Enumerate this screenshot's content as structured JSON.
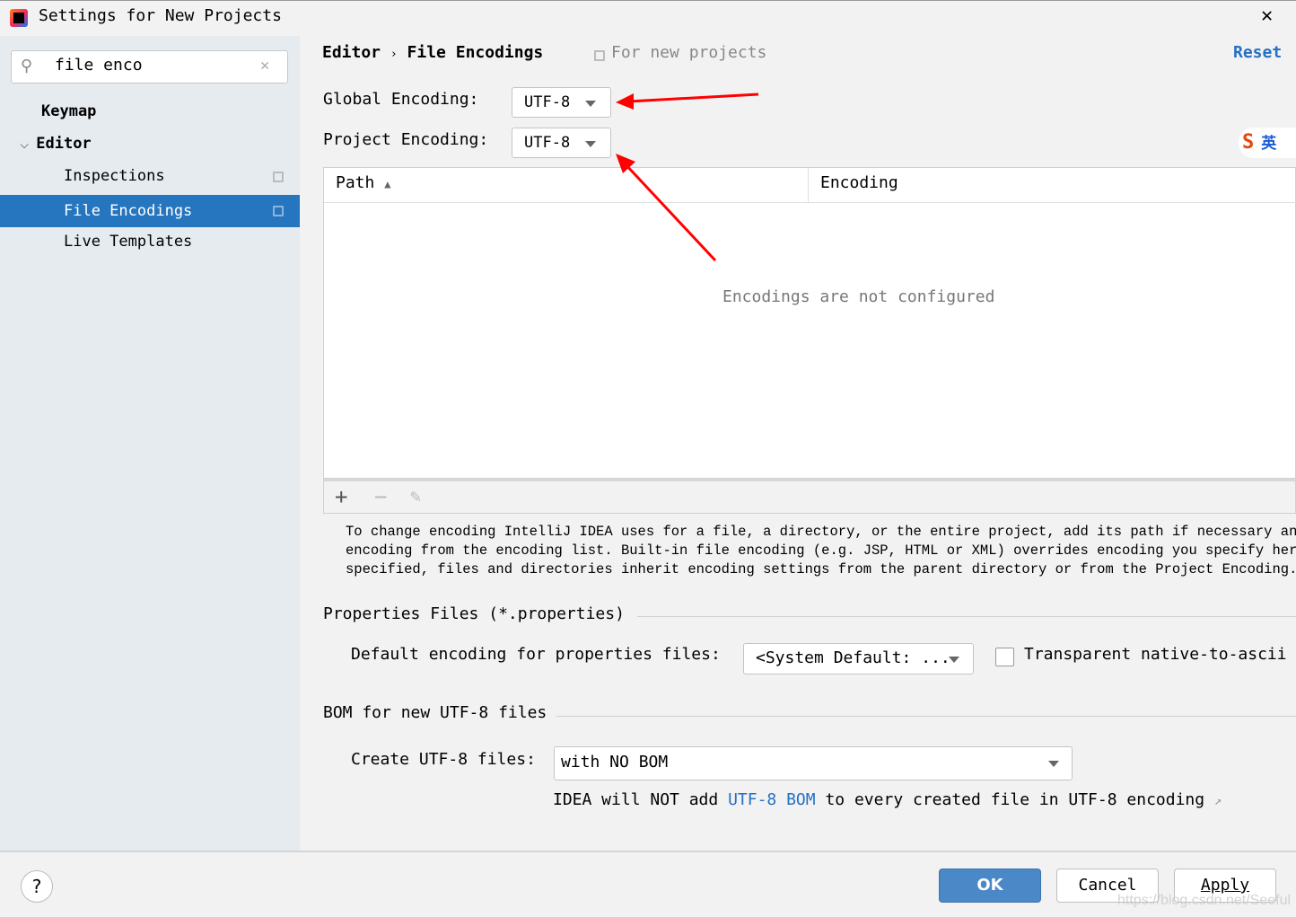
{
  "window": {
    "title": "Settings for New Projects",
    "close_icon": "close-icon"
  },
  "sidebar": {
    "search_value": "file enco",
    "items": [
      {
        "label": "Keymap"
      },
      {
        "label": "Editor"
      },
      {
        "label": "Inspections"
      },
      {
        "label": "File Encodings",
        "selected": true
      },
      {
        "label": "Live Templates"
      }
    ]
  },
  "header": {
    "breadcrumb": [
      "Editor",
      "File Encodings"
    ],
    "scope": "For new projects",
    "reset": "Reset"
  },
  "encodings": {
    "global_label": "Global Encoding:",
    "global_value": "UTF-8",
    "project_label": "Project Encoding:",
    "project_value": "UTF-8"
  },
  "table": {
    "columns": [
      "Path",
      "Encoding"
    ],
    "empty_text": "Encodings are not configured"
  },
  "help_text": [
    "To change encoding IntelliJ IDEA uses for a file, a directory, or the entire project, add its path if necessary and th",
    "encoding from the encoding list. Built-in file encoding (e.g. JSP, HTML or XML) overrides encoding you specify here. I",
    "specified, files and directories inherit encoding settings from the parent directory or from the Project Encoding."
  ],
  "properties": {
    "section": "Properties Files (*.properties)",
    "label": "Default encoding for properties files:",
    "value": "<System Default: ...",
    "checkbox_label": "Transparent native-to-ascii",
    "checked": false
  },
  "bom": {
    "section": "BOM for new UTF-8 files",
    "label": "Create UTF-8 files:",
    "value": "with NO BOM",
    "note_pre": "IDEA will NOT add ",
    "note_link": "UTF-8 BOM",
    "note_post": " to every created file in UTF-8 encoding"
  },
  "footer": {
    "ok": "OK",
    "cancel": "Cancel",
    "apply": "Apply"
  },
  "ime_badge": "英",
  "watermark": "https://blog.csdn.net/Seeful",
  "colors": {
    "accent": "#2675bf",
    "link": "#2470c2",
    "arrow": "#ff0000"
  }
}
